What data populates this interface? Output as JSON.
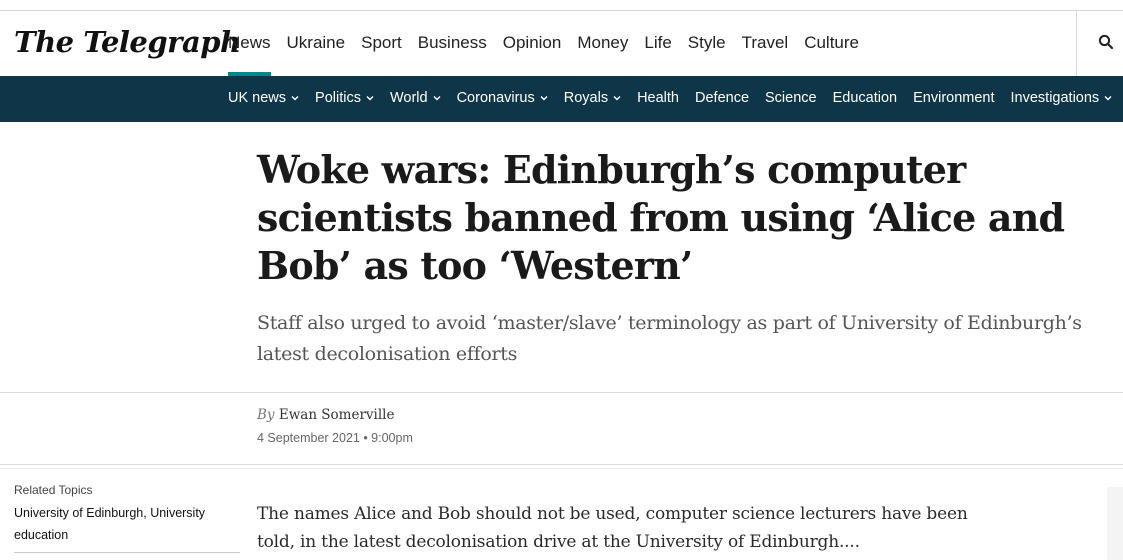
{
  "site": {
    "logo_text": "The Telegraph",
    "accent": "#00868b",
    "subnav_bg": "#0e3648"
  },
  "main_nav": [
    {
      "label": "News"
    },
    {
      "label": "Ukraine"
    },
    {
      "label": "Sport"
    },
    {
      "label": "Business"
    },
    {
      "label": "Opinion"
    },
    {
      "label": "Money"
    },
    {
      "label": "Life"
    },
    {
      "label": "Style"
    },
    {
      "label": "Travel"
    },
    {
      "label": "Culture"
    }
  ],
  "search_icon": "search-icon",
  "sub_nav": [
    {
      "label": "UK news",
      "has_menu": true
    },
    {
      "label": "Politics",
      "has_menu": true
    },
    {
      "label": "World",
      "has_menu": true
    },
    {
      "label": "Coronavirus",
      "has_menu": true
    },
    {
      "label": "Royals",
      "has_menu": true
    },
    {
      "label": "Health",
      "has_menu": false
    },
    {
      "label": "Defence",
      "has_menu": false
    },
    {
      "label": "Science",
      "has_menu": false
    },
    {
      "label": "Education",
      "has_menu": false
    },
    {
      "label": "Environment",
      "has_menu": false
    },
    {
      "label": "Investigations",
      "has_menu": true
    }
  ],
  "article": {
    "headline": "Woke wars: Edinburgh’s computer scientists banned from using ‘Alice and Bob’ as too ‘Western’",
    "standfirst": "Staff also urged to avoid ‘master/slave’ terminology as part of University of Edinburgh’s latest decolonisation efforts",
    "by_label": "By",
    "author": "Ewan Somerville",
    "date": "4 September 2021 • 9:00pm",
    "body_first_para": "The names Alice and Bob should not be used, computer science lecturers have been told, in the latest decolonisation drive at the University of Edinburgh...."
  },
  "related": {
    "title": "Related Topics",
    "topics": [
      {
        "label": "University of Edinburgh,"
      },
      {
        "label": "University education"
      }
    ]
  }
}
